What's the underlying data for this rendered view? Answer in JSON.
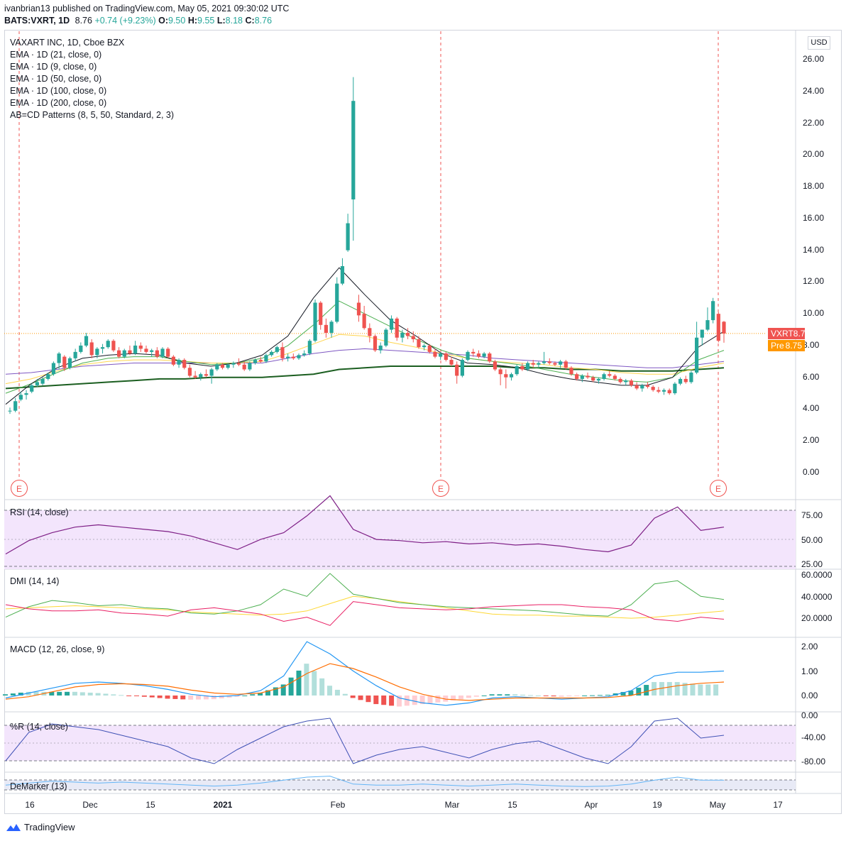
{
  "header": {
    "line1": "ivanbrian13 published on TradingView.com, May 05, 2021 09:30:02 UTC",
    "symbol": "BATS:VXRT, 1D",
    "last": "8.76",
    "change": "+0.74 (+9.23%)",
    "o_label": "O:",
    "o": "9.50",
    "h_label": "H:",
    "h": "9.55",
    "l_label": "L:",
    "l": "8.18",
    "c_label": "C:",
    "c": "8.76"
  },
  "legend": [
    "VAXART INC, 1D, Cboe BZX",
    "EMA · 1D (21, close, 0)",
    "EMA · 1D (9, close, 0)",
    "EMA · 1D (50, close, 0)",
    "EMA · 1D (100, close, 0)",
    "EMA · 1D (200, close, 0)",
    "AB=CD Patterns (8, 5, 50, Standard, 2, 3)"
  ],
  "currency": "USD",
  "badges": {
    "last_label": "VXRT",
    "last_value": "8.76",
    "pre_label": "Pre",
    "pre_value": "8.75"
  },
  "earnings_marker": "E",
  "price_axis": [
    "26.00",
    "24.00",
    "22.00",
    "20.00",
    "18.00",
    "16.00",
    "14.00",
    "12.00",
    "10.00",
    "8.00",
    "6.00",
    "4.00",
    "2.00",
    "0.00"
  ],
  "indicators": {
    "rsi": {
      "label": "RSI (14, close)",
      "ticks": [
        "75.00",
        "50.00",
        "25.00"
      ]
    },
    "dmi": {
      "label": "DMI (14, 14)",
      "ticks": [
        "60.0000",
        "40.0000",
        "20.0000"
      ]
    },
    "macd": {
      "label": "MACD (12, 26, close, 9)",
      "ticks": [
        "2.00",
        "1.00",
        "0.00"
      ]
    },
    "wr": {
      "label": "%R (14, close)",
      "ticks": [
        "0.00",
        "-40.00",
        "-80.00"
      ]
    },
    "demarker": {
      "label": "DeMarker (13)"
    }
  },
  "date_axis": [
    "16",
    "Dec",
    "15",
    "2021",
    "Feb",
    "Mar",
    "15",
    "Apr",
    "19",
    "May",
    "17"
  ],
  "footer": {
    "brand": "TradingView"
  },
  "colors": {
    "up": "#26a69a",
    "down": "#ef5350",
    "pre": "#ff9800",
    "ema9": "#131722",
    "ema21": "#4caf50",
    "ema50": "#ffd54f",
    "ema100": "#7e57c2",
    "ema200": "#1b5e20"
  },
  "chart_data": {
    "type": "candlestick",
    "title": "VAXART INC, 1D, Cboe BZX",
    "ylim": [
      0,
      26
    ],
    "y_unit": "USD",
    "candles": [
      {
        "o": 3.9,
        "h": 4.1,
        "l": 3.7,
        "c": 3.9
      },
      {
        "o": 3.9,
        "h": 4.7,
        "l": 3.8,
        "c": 4.5
      },
      {
        "o": 4.6,
        "h": 5.1,
        "l": 4.5,
        "c": 4.9
      },
      {
        "o": 4.9,
        "h": 5.2,
        "l": 4.6,
        "c": 5.0
      },
      {
        "o": 5.1,
        "h": 5.6,
        "l": 5.0,
        "c": 5.5
      },
      {
        "o": 5.5,
        "h": 5.9,
        "l": 5.4,
        "c": 5.7
      },
      {
        "o": 5.6,
        "h": 6.0,
        "l": 5.5,
        "c": 5.9
      },
      {
        "o": 5.9,
        "h": 6.3,
        "l": 5.8,
        "c": 6.2
      },
      {
        "o": 6.2,
        "h": 7.0,
        "l": 6.1,
        "c": 6.9
      },
      {
        "o": 6.9,
        "h": 7.6,
        "l": 6.5,
        "c": 7.5
      },
      {
        "o": 7.3,
        "h": 7.4,
        "l": 6.4,
        "c": 6.6
      },
      {
        "o": 6.6,
        "h": 7.3,
        "l": 6.5,
        "c": 7.2
      },
      {
        "o": 7.2,
        "h": 7.8,
        "l": 7.0,
        "c": 7.6
      },
      {
        "o": 7.6,
        "h": 8.2,
        "l": 7.5,
        "c": 8.0
      },
      {
        "o": 8.0,
        "h": 8.8,
        "l": 7.9,
        "c": 8.6
      },
      {
        "o": 8.2,
        "h": 8.4,
        "l": 7.2,
        "c": 7.4
      },
      {
        "o": 7.4,
        "h": 7.9,
        "l": 7.2,
        "c": 7.8
      },
      {
        "o": 7.8,
        "h": 8.1,
        "l": 7.5,
        "c": 7.9
      },
      {
        "o": 7.9,
        "h": 8.4,
        "l": 7.8,
        "c": 8.3
      },
      {
        "o": 8.3,
        "h": 8.4,
        "l": 7.6,
        "c": 7.7
      },
      {
        "o": 7.7,
        "h": 7.9,
        "l": 7.2,
        "c": 7.3
      },
      {
        "o": 7.3,
        "h": 7.8,
        "l": 7.2,
        "c": 7.7
      },
      {
        "o": 7.7,
        "h": 8.0,
        "l": 7.4,
        "c": 7.5
      },
      {
        "o": 7.5,
        "h": 8.3,
        "l": 7.4,
        "c": 8.0
      },
      {
        "o": 8.0,
        "h": 8.2,
        "l": 7.6,
        "c": 7.8
      },
      {
        "o": 7.8,
        "h": 8.0,
        "l": 7.5,
        "c": 7.6
      },
      {
        "o": 7.6,
        "h": 7.8,
        "l": 7.3,
        "c": 7.7
      },
      {
        "o": 7.7,
        "h": 7.9,
        "l": 7.2,
        "c": 7.3
      },
      {
        "o": 7.3,
        "h": 7.9,
        "l": 7.2,
        "c": 7.8
      },
      {
        "o": 7.8,
        "h": 7.9,
        "l": 7.2,
        "c": 7.3
      },
      {
        "o": 7.3,
        "h": 7.4,
        "l": 6.7,
        "c": 6.8
      },
      {
        "o": 6.8,
        "h": 7.2,
        "l": 6.6,
        "c": 7.1
      },
      {
        "o": 7.1,
        "h": 7.2,
        "l": 6.5,
        "c": 6.6
      },
      {
        "o": 6.6,
        "h": 6.8,
        "l": 6.0,
        "c": 6.1
      },
      {
        "o": 6.1,
        "h": 6.4,
        "l": 5.9,
        "c": 6.0
      },
      {
        "o": 6.0,
        "h": 6.3,
        "l": 5.8,
        "c": 6.2
      },
      {
        "o": 6.2,
        "h": 6.5,
        "l": 6.0,
        "c": 6.1
      },
      {
        "o": 6.1,
        "h": 6.6,
        "l": 5.6,
        "c": 6.5
      },
      {
        "o": 6.5,
        "h": 6.9,
        "l": 6.4,
        "c": 6.8
      },
      {
        "o": 6.8,
        "h": 6.9,
        "l": 6.5,
        "c": 6.6
      },
      {
        "o": 6.6,
        "h": 6.9,
        "l": 6.5,
        "c": 6.8
      },
      {
        "o": 6.8,
        "h": 7.0,
        "l": 6.6,
        "c": 6.9
      },
      {
        "o": 6.9,
        "h": 7.2,
        "l": 6.7,
        "c": 6.8
      },
      {
        "o": 6.8,
        "h": 7.0,
        "l": 6.4,
        "c": 6.5
      },
      {
        "o": 6.5,
        "h": 7.0,
        "l": 6.4,
        "c": 6.9
      },
      {
        "o": 6.9,
        "h": 7.2,
        "l": 6.8,
        "c": 7.1
      },
      {
        "o": 7.1,
        "h": 7.3,
        "l": 6.9,
        "c": 7.0
      },
      {
        "o": 7.0,
        "h": 7.5,
        "l": 6.9,
        "c": 7.4
      },
      {
        "o": 7.4,
        "h": 7.7,
        "l": 7.3,
        "c": 7.6
      },
      {
        "o": 7.6,
        "h": 8.0,
        "l": 7.5,
        "c": 7.9
      },
      {
        "o": 7.9,
        "h": 8.2,
        "l": 7.0,
        "c": 7.2
      },
      {
        "o": 7.2,
        "h": 7.5,
        "l": 7.0,
        "c": 7.3
      },
      {
        "o": 7.3,
        "h": 7.5,
        "l": 7.1,
        "c": 7.2
      },
      {
        "o": 7.2,
        "h": 7.5,
        "l": 7.1,
        "c": 7.4
      },
      {
        "o": 7.4,
        "h": 7.7,
        "l": 7.3,
        "c": 7.5
      },
      {
        "o": 7.5,
        "h": 8.4,
        "l": 7.4,
        "c": 8.3
      },
      {
        "o": 8.3,
        "h": 10.9,
        "l": 8.2,
        "c": 10.7
      },
      {
        "o": 10.7,
        "h": 10.8,
        "l": 9.0,
        "c": 9.3
      },
      {
        "o": 9.3,
        "h": 9.7,
        "l": 8.5,
        "c": 8.8
      },
      {
        "o": 8.8,
        "h": 9.6,
        "l": 8.5,
        "c": 9.5
      },
      {
        "o": 9.5,
        "h": 12.3,
        "l": 9.4,
        "c": 11.9
      },
      {
        "o": 11.9,
        "h": 13.5,
        "l": 11.8,
        "c": 13.0
      },
      {
        "o": 14.0,
        "h": 16.3,
        "l": 13.9,
        "c": 15.7
      },
      {
        "o": 17.2,
        "h": 24.9,
        "l": 14.6,
        "c": 23.4
      },
      {
        "o": 10.7,
        "h": 11.2,
        "l": 9.5,
        "c": 9.9
      },
      {
        "o": 10.0,
        "h": 10.5,
        "l": 9.0,
        "c": 9.1
      },
      {
        "o": 9.1,
        "h": 9.4,
        "l": 8.2,
        "c": 8.6
      },
      {
        "o": 8.6,
        "h": 8.7,
        "l": 7.6,
        "c": 7.7
      },
      {
        "o": 7.7,
        "h": 8.2,
        "l": 7.5,
        "c": 8.0
      },
      {
        "o": 8.0,
        "h": 9.1,
        "l": 7.9,
        "c": 9.0
      },
      {
        "o": 9.0,
        "h": 9.9,
        "l": 8.8,
        "c": 9.7
      },
      {
        "o": 9.7,
        "h": 9.8,
        "l": 8.3,
        "c": 8.5
      },
      {
        "o": 8.5,
        "h": 9.0,
        "l": 8.2,
        "c": 8.8
      },
      {
        "o": 8.8,
        "h": 9.1,
        "l": 8.4,
        "c": 8.6
      },
      {
        "o": 8.6,
        "h": 8.9,
        "l": 8.2,
        "c": 8.4
      },
      {
        "o": 8.4,
        "h": 8.6,
        "l": 7.8,
        "c": 7.9
      },
      {
        "o": 7.9,
        "h": 8.1,
        "l": 7.7,
        "c": 8.0
      },
      {
        "o": 8.0,
        "h": 8.1,
        "l": 7.5,
        "c": 7.6
      },
      {
        "o": 7.6,
        "h": 7.8,
        "l": 7.2,
        "c": 7.3
      },
      {
        "o": 7.3,
        "h": 7.6,
        "l": 7.1,
        "c": 7.5
      },
      {
        "o": 7.5,
        "h": 7.6,
        "l": 7.0,
        "c": 7.1
      },
      {
        "o": 7.1,
        "h": 7.3,
        "l": 6.7,
        "c": 6.8
      },
      {
        "o": 6.8,
        "h": 7.0,
        "l": 5.6,
        "c": 6.1
      },
      {
        "o": 6.1,
        "h": 7.2,
        "l": 6.0,
        "c": 7.1
      },
      {
        "o": 7.1,
        "h": 7.7,
        "l": 7.0,
        "c": 7.6
      },
      {
        "o": 7.6,
        "h": 7.8,
        "l": 7.3,
        "c": 7.5
      },
      {
        "o": 7.5,
        "h": 7.7,
        "l": 7.2,
        "c": 7.3
      },
      {
        "o": 7.3,
        "h": 7.6,
        "l": 7.2,
        "c": 7.5
      },
      {
        "o": 7.5,
        "h": 7.6,
        "l": 6.9,
        "c": 7.0
      },
      {
        "o": 7.0,
        "h": 7.1,
        "l": 6.4,
        "c": 6.5
      },
      {
        "o": 6.5,
        "h": 6.6,
        "l": 5.5,
        "c": 6.2
      },
      {
        "o": 6.2,
        "h": 6.5,
        "l": 5.3,
        "c": 6.0
      },
      {
        "o": 6.0,
        "h": 6.3,
        "l": 5.8,
        "c": 6.2
      },
      {
        "o": 6.2,
        "h": 6.8,
        "l": 6.1,
        "c": 6.7
      },
      {
        "o": 6.7,
        "h": 6.9,
        "l": 6.4,
        "c": 6.5
      },
      {
        "o": 6.5,
        "h": 7.0,
        "l": 6.4,
        "c": 6.9
      },
      {
        "o": 6.9,
        "h": 7.1,
        "l": 6.6,
        "c": 6.8
      },
      {
        "o": 6.8,
        "h": 7.0,
        "l": 6.6,
        "c": 6.9
      },
      {
        "o": 6.9,
        "h": 7.6,
        "l": 6.8,
        "c": 7.0
      },
      {
        "o": 7.0,
        "h": 7.2,
        "l": 6.8,
        "c": 6.9
      },
      {
        "o": 6.9,
        "h": 7.0,
        "l": 6.7,
        "c": 6.8
      },
      {
        "o": 6.8,
        "h": 7.1,
        "l": 6.6,
        "c": 7.0
      },
      {
        "o": 7.0,
        "h": 7.1,
        "l": 6.5,
        "c": 6.6
      },
      {
        "o": 6.6,
        "h": 6.7,
        "l": 6.1,
        "c": 6.2
      },
      {
        "o": 6.2,
        "h": 6.3,
        "l": 5.8,
        "c": 5.9
      },
      {
        "o": 5.9,
        "h": 6.2,
        "l": 5.7,
        "c": 6.1
      },
      {
        "o": 6.1,
        "h": 6.3,
        "l": 5.9,
        "c": 6.0
      },
      {
        "o": 6.0,
        "h": 6.1,
        "l": 5.7,
        "c": 5.8
      },
      {
        "o": 5.8,
        "h": 6.0,
        "l": 5.6,
        "c": 5.9
      },
      {
        "o": 5.9,
        "h": 6.3,
        "l": 5.8,
        "c": 6.2
      },
      {
        "o": 6.2,
        "h": 6.4,
        "l": 6.0,
        "c": 6.1
      },
      {
        "o": 6.1,
        "h": 6.2,
        "l": 5.8,
        "c": 5.9
      },
      {
        "o": 5.9,
        "h": 6.0,
        "l": 5.6,
        "c": 5.7
      },
      {
        "o": 5.7,
        "h": 5.9,
        "l": 5.5,
        "c": 5.8
      },
      {
        "o": 5.8,
        "h": 5.9,
        "l": 5.4,
        "c": 5.5
      },
      {
        "o": 5.5,
        "h": 5.7,
        "l": 5.2,
        "c": 5.3
      },
      {
        "o": 5.3,
        "h": 5.6,
        "l": 5.1,
        "c": 5.5
      },
      {
        "o": 5.5,
        "h": 5.7,
        "l": 5.3,
        "c": 5.4
      },
      {
        "o": 5.4,
        "h": 5.5,
        "l": 5.1,
        "c": 5.2
      },
      {
        "o": 5.2,
        "h": 5.4,
        "l": 5.0,
        "c": 5.1
      },
      {
        "o": 5.1,
        "h": 5.3,
        "l": 4.9,
        "c": 5.2
      },
      {
        "o": 5.2,
        "h": 5.3,
        "l": 4.9,
        "c": 5.0
      },
      {
        "o": 5.0,
        "h": 5.7,
        "l": 4.9,
        "c": 5.6
      },
      {
        "o": 5.6,
        "h": 6.0,
        "l": 5.5,
        "c": 5.9
      },
      {
        "o": 5.9,
        "h": 6.1,
        "l": 5.6,
        "c": 5.7
      },
      {
        "o": 5.7,
        "h": 6.4,
        "l": 5.6,
        "c": 6.3
      },
      {
        "o": 6.3,
        "h": 9.5,
        "l": 6.2,
        "c": 8.5
      },
      {
        "o": 8.5,
        "h": 9.0,
        "l": 8.0,
        "c": 9.0
      },
      {
        "o": 9.0,
        "h": 10.4,
        "l": 8.9,
        "c": 9.6
      },
      {
        "o": 9.6,
        "h": 11.0,
        "l": 9.4,
        "c": 10.8
      },
      {
        "o": 10.0,
        "h": 10.1,
        "l": 8.2,
        "c": 8.3
      },
      {
        "o": 9.5,
        "h": 9.55,
        "l": 8.18,
        "c": 8.76
      }
    ],
    "ema9": [
      4.3,
      5.6,
      6.6,
      7.2,
      7.4,
      7.5,
      7.4,
      6.9,
      6.7,
      6.9,
      7.4,
      8.6,
      11.0,
      12.9,
      11.2,
      9.6,
      8.6,
      7.5,
      6.9,
      6.8,
      6.6,
      6.2,
      5.9,
      5.7,
      5.5,
      5.5,
      6.0,
      7.9,
      8.9
    ],
    "ema21": [
      5.0,
      5.6,
      6.3,
      6.9,
      7.2,
      7.3,
      7.3,
      7.0,
      6.8,
      6.9,
      7.2,
      8.0,
      9.3,
      10.8,
      10.0,
      9.2,
      8.4,
      7.7,
      7.2,
      7.0,
      6.8,
      6.5,
      6.2,
      6.0,
      5.8,
      5.7,
      6.0,
      7.1,
      7.7
    ],
    "ema50": [
      5.6,
      5.9,
      6.4,
      6.8,
      7.0,
      7.1,
      7.1,
      7.0,
      6.9,
      6.9,
      7.0,
      7.5,
      8.1,
      8.7,
      8.6,
      8.2,
      7.9,
      7.5,
      7.2,
      7.0,
      6.9,
      6.8,
      6.6,
      6.5,
      6.3,
      6.2,
      6.2,
      6.6,
      6.9
    ],
    "ema100": [
      6.2,
      6.3,
      6.5,
      6.7,
      6.8,
      6.9,
      6.9,
      6.9,
      6.9,
      6.9,
      6.9,
      7.2,
      7.5,
      7.7,
      7.8,
      7.7,
      7.6,
      7.5,
      7.4,
      7.2,
      7.1,
      7.0,
      6.9,
      6.8,
      6.7,
      6.6,
      6.6,
      6.8,
      7.0
    ],
    "ema200": [
      5.3,
      5.4,
      5.5,
      5.6,
      5.7,
      5.8,
      5.9,
      5.9,
      6.0,
      6.0,
      6.0,
      6.1,
      6.2,
      6.5,
      6.6,
      6.7,
      6.7,
      6.7,
      6.7,
      6.7,
      6.6,
      6.6,
      6.5,
      6.5,
      6.4,
      6.4,
      6.4,
      6.5,
      6.6
    ],
    "rsi": [
      36,
      48,
      55,
      60,
      62,
      60,
      58,
      56,
      52,
      46,
      40,
      49,
      55,
      70,
      88,
      58,
      49,
      48,
      46,
      47,
      45,
      46,
      44,
      45,
      43,
      40,
      38,
      44,
      68,
      78,
      57,
      60
    ],
    "dmi_plus": [
      18,
      28,
      34,
      32,
      29,
      30,
      27,
      26,
      22,
      21,
      24,
      30,
      45,
      38,
      60,
      40,
      36,
      32,
      30,
      28,
      27,
      26,
      25,
      24,
      22,
      20,
      19,
      30,
      50,
      53,
      38,
      35
    ],
    "dmi_minus": [
      30,
      26,
      24,
      24,
      25,
      22,
      21,
      19,
      25,
      27,
      24,
      21,
      14,
      18,
      10,
      33,
      30,
      27,
      26,
      25,
      26,
      28,
      29,
      30,
      30,
      28,
      27,
      25,
      16,
      14,
      18,
      16
    ],
    "adx": [
      26,
      27,
      28,
      29,
      28,
      27,
      26,
      25,
      23,
      22,
      21,
      20,
      21,
      24,
      31,
      38,
      36,
      33,
      30,
      27,
      24,
      21,
      20,
      20,
      19,
      19,
      18,
      17,
      18,
      20,
      22,
      24
    ],
    "macd_line": [
      -0.1,
      0.1,
      0.3,
      0.5,
      0.55,
      0.5,
      0.4,
      0.25,
      0.05,
      -0.05,
      0.0,
      0.2,
      0.8,
      2.2,
      1.7,
      1.0,
      0.4,
      -0.1,
      -0.3,
      -0.4,
      -0.3,
      -0.1,
      -0.05,
      -0.1,
      -0.15,
      -0.1,
      -0.05,
      0.2,
      0.8,
      0.95,
      0.95,
      1.0
    ],
    "macd_signal": [
      -0.15,
      -0.05,
      0.15,
      0.35,
      0.45,
      0.48,
      0.45,
      0.38,
      0.22,
      0.1,
      0.05,
      0.1,
      0.35,
      0.9,
      1.3,
      1.1,
      0.75,
      0.35,
      0.05,
      -0.15,
      -0.2,
      -0.15,
      -0.1,
      -0.1,
      -0.1,
      -0.1,
      -0.08,
      0.0,
      0.25,
      0.4,
      0.5,
      0.55
    ],
    "wr": [
      -80,
      -30,
      -15,
      -20,
      -25,
      -35,
      -45,
      -55,
      -75,
      -85,
      -60,
      -40,
      -20,
      -10,
      -5,
      -85,
      -70,
      -60,
      -55,
      -65,
      -75,
      -60,
      -50,
      -45,
      -60,
      -75,
      -85,
      -55,
      -10,
      -5,
      -40,
      -35
    ],
    "demarker": [
      0.35,
      0.45,
      0.55,
      0.5,
      0.45,
      0.5,
      0.45,
      0.4,
      0.35,
      0.3,
      0.35,
      0.45,
      0.6,
      0.75,
      0.8,
      0.4,
      0.35,
      0.35,
      0.4,
      0.35,
      0.3,
      0.35,
      0.4,
      0.35,
      0.3,
      0.28,
      0.3,
      0.4,
      0.6,
      0.75,
      0.6,
      0.6
    ]
  }
}
